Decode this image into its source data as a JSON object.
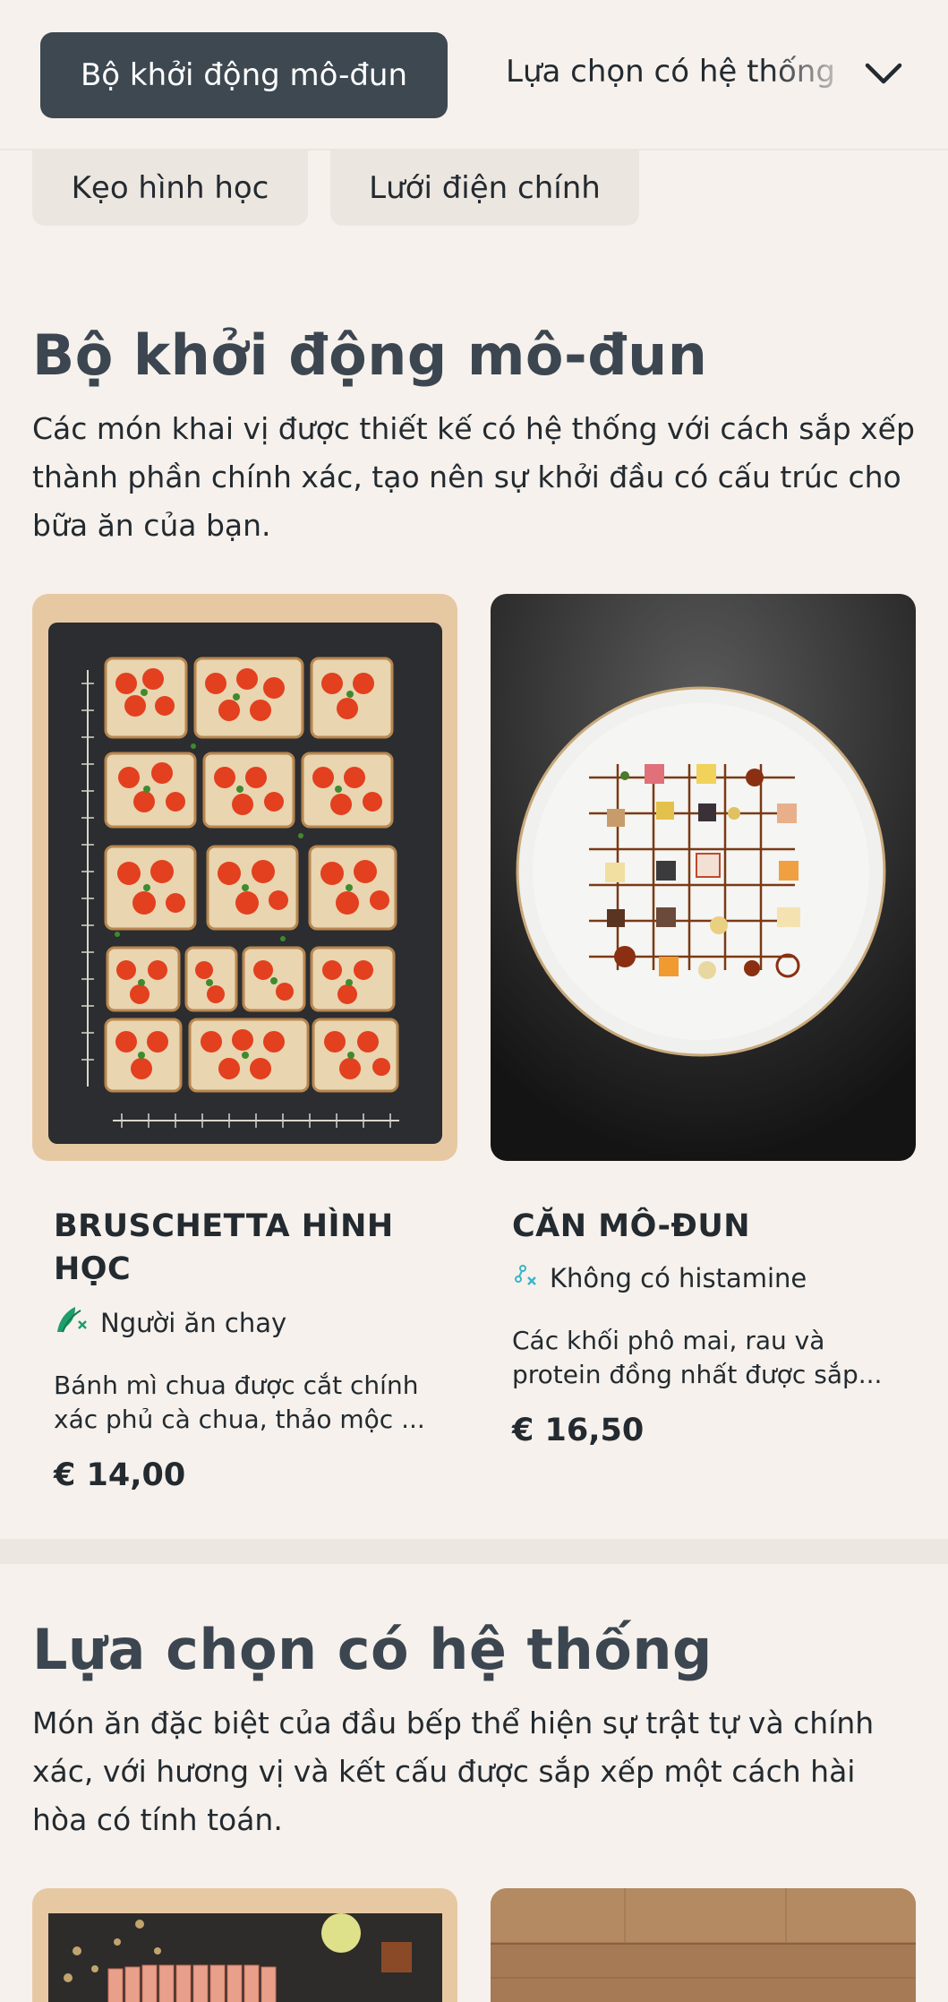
{
  "tabs": [
    {
      "label": "Bộ khởi động mô-đun",
      "active": true
    },
    {
      "label": "Lựa chọn có hệ thống",
      "active": false
    }
  ],
  "chips": [
    "Kẹo hình học",
    "Lưới điện chính"
  ],
  "section1": {
    "title": "Bộ khởi động mô-đun",
    "description": "Các món khai vị được thiết kế có hệ thống với cách sắp xếp thành phần chính xác, tạo nên sự khởi đầu có cấu trúc cho bữa ăn của bạn.",
    "cards": [
      {
        "title": "BRUSCHETTA HÌNH HỌC",
        "tag_label": "Người ăn chay",
        "tag_icon": "vegetarian-icon",
        "description": "Bánh mì chua được cắt chính xác phủ cà chua, thảo mộc ...",
        "price": "€ 14,00"
      },
      {
        "title": "CĂN MÔ-ĐUN",
        "tag_label": "Không có histamine",
        "tag_icon": "histamine-free-icon",
        "description": "Các khối phô mai, rau và protein đồng nhất được sắp...",
        "price": "€ 16,50"
      }
    ]
  },
  "section2": {
    "title": "Lựa chọn có hệ thống",
    "description": "Món ăn đặc biệt của đầu bếp thể hiện sự trật tự và chính xác, với hương vị và kết cấu được sắp xếp một cách hài hòa có tính toán."
  },
  "colors": {
    "background": "#f6f1ec",
    "tab_active": "#3e4851",
    "heading": "#3c4650",
    "vegetarian_green": "#1f9d6b",
    "histamine_teal": "#38b6c8"
  }
}
